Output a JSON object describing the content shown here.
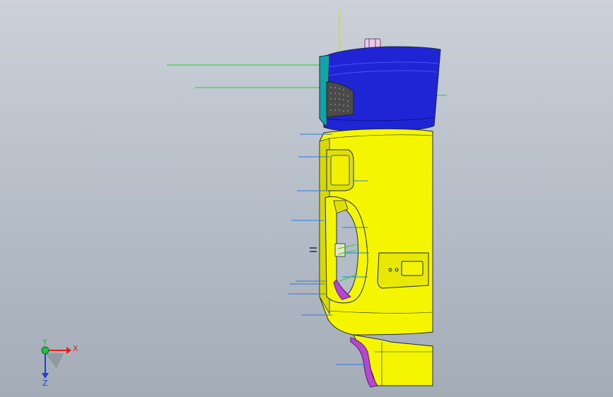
{
  "viewport": {
    "background_top": "#ccd1d9",
    "background_bottom": "#a3acb7"
  },
  "model": {
    "name": "3d-cad-model",
    "colors": {
      "body": "#f5f500",
      "cap": "#1f24d4",
      "cap_highlight": "#3a40f0",
      "accent": "#b347d1",
      "edge": "#1e2a44",
      "leader_blue": "#2e7bd8",
      "leader_green": "#1fd61f",
      "grille": "#555555"
    }
  },
  "triad": {
    "x_label": "X",
    "y_label": "Y",
    "z_label": "Z",
    "x_color": "#e02020",
    "y_color": "#20c040",
    "z_color": "#2040d0"
  }
}
